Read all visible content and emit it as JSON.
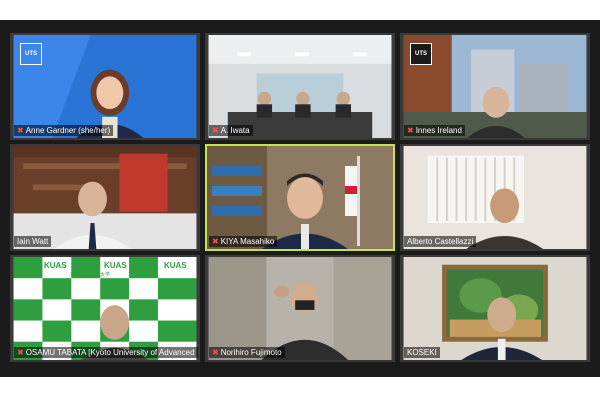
{
  "meeting": {
    "participants": [
      {
        "name": "Anne Gardner (she/her)",
        "muted": true
      },
      {
        "name": "A. Iwata",
        "muted": true
      },
      {
        "name": "Innes Ireland",
        "muted": true
      },
      {
        "name": "Iain Watt",
        "muted": false
      },
      {
        "name": "KIYA Masahiko",
        "muted": true,
        "active_speaker": true
      },
      {
        "name": "Alberto Castellazzi",
        "muted": false
      },
      {
        "name": "OSAMU TABATA [Kyoto University of Advanced",
        "muted": true
      },
      {
        "name": "Norihiro Fujimoto",
        "muted": true
      },
      {
        "name": "KOSEKI",
        "muted": false
      }
    ]
  },
  "branding": {
    "uts_logo": "UTS",
    "kuas_logo": "KUAS",
    "kuas_tagline": "京都先端科学大学"
  },
  "colors": {
    "active_border": "#c7e34a",
    "mute_icon": "#ff4d4d",
    "frame": "#1b1b1b",
    "kuas_green": "#2e9e3e"
  },
  "icons": [
    "microphone-muted-icon",
    "uts-logo",
    "kuas-logo"
  ]
}
